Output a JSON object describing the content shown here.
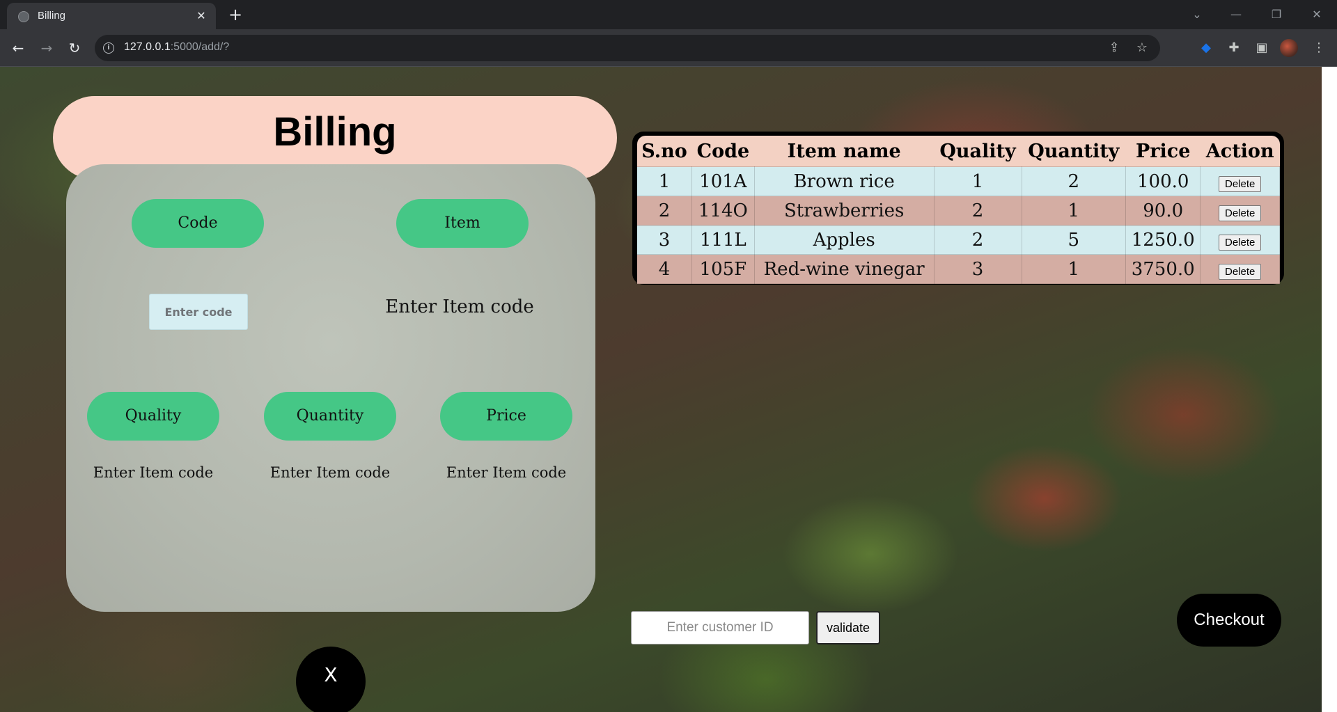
{
  "browser": {
    "tab_title": "Billing",
    "tab_close": "✕",
    "new_tab": "+",
    "url_host": "127.0.0.1",
    "url_path": ":5000/add/?"
  },
  "page": {
    "title": "Billing",
    "form": {
      "code_label": "Code",
      "item_label": "Item",
      "code_placeholder": "Enter code",
      "item_value": "Enter Item code",
      "quality_label": "Quality",
      "quantity_label": "Quantity",
      "price_label": "Price",
      "quality_value": "Enter Item code",
      "quantity_value": "Enter Item code",
      "price_value": "Enter Item code"
    },
    "close_button": "X",
    "table": {
      "headers": [
        "S.no",
        "Code",
        "Item name",
        "Quality",
        "Quantity",
        "Price",
        "Action"
      ],
      "rows": [
        {
          "sno": "1",
          "code": "101A",
          "name": "Brown rice",
          "quality": "1",
          "quantity": "2",
          "price": "100.0",
          "action": "Delete"
        },
        {
          "sno": "2",
          "code": "114O",
          "name": "Strawberries",
          "quality": "2",
          "quantity": "1",
          "price": "90.0",
          "action": "Delete"
        },
        {
          "sno": "3",
          "code": "111L",
          "name": "Apples",
          "quality": "2",
          "quantity": "5",
          "price": "1250.0",
          "action": "Delete"
        },
        {
          "sno": "4",
          "code": "105F",
          "name": "Red-wine vinegar",
          "quality": "3",
          "quantity": "1",
          "price": "3750.0",
          "action": "Delete"
        }
      ]
    },
    "customer_placeholder": "Enter customer ID",
    "validate_label": "validate",
    "checkout_label": "Checkout"
  }
}
